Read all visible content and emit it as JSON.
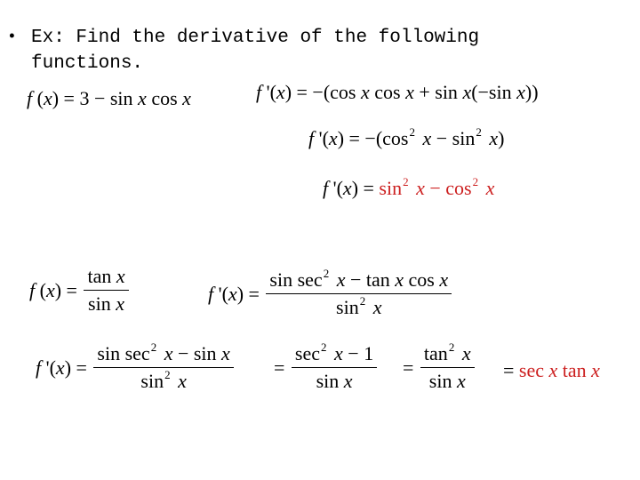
{
  "slide": {
    "bullet_glyph": "•",
    "intro_line1": "Ex: Find the derivative of the following",
    "intro_line2": "functions.",
    "accent_color": "#cc1f1f"
  },
  "problem1": {
    "given": {
      "lhs": "f (x)",
      "eq": "=",
      "rhs_text": "3 − sin x cos x"
    },
    "step1": {
      "lhs": "f '(x)",
      "eq": "=",
      "rhs_text": "−(cos x cos x + sin x(−sin x))"
    },
    "step2": {
      "lhs": "f '(x)",
      "eq": "=",
      "rhs_text": "−(cos² x − sin² x)"
    },
    "answer": {
      "lhs": "f '(x)",
      "eq": "=",
      "rhs_text": "sin² x − cos² x"
    }
  },
  "problem2": {
    "given": {
      "lhs": "f (x)",
      "eq": "=",
      "numerator": "tan x",
      "denominator": "sin x"
    },
    "step1": {
      "lhs": "f '(x)",
      "eq": "=",
      "numerator": "sin sec² x − tan x cos x",
      "denominator": "sin² x"
    },
    "step2": {
      "lhs": "f '(x)",
      "eq": "=",
      "numerator": "sin sec² x − sin x",
      "denominator": "sin² x"
    },
    "step3": {
      "eq": "=",
      "numerator": "sec² x − 1",
      "denominator": "sin x"
    },
    "step4": {
      "eq": "=",
      "numerator": "tan² x",
      "denominator": "sin x"
    },
    "answer": {
      "eq": "=",
      "rhs_text": "sec x tan x"
    }
  }
}
